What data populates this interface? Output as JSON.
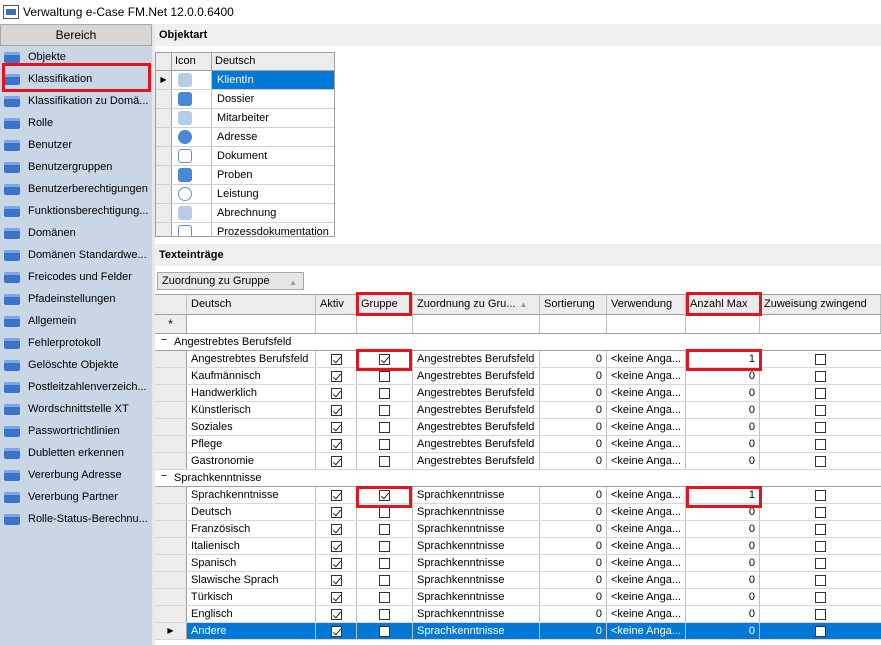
{
  "window": {
    "title": "Verwaltung e-Case FM.Net 12.0.0.6400"
  },
  "sidebar": {
    "header": "Bereich",
    "items": [
      {
        "label": "Objekte"
      },
      {
        "label": "Klassifikation"
      },
      {
        "label": "Klassifikation zu Domä..."
      },
      {
        "label": "Rolle"
      },
      {
        "label": "Benutzer"
      },
      {
        "label": "Benutzergruppen"
      },
      {
        "label": "Benutzerberechtigungen"
      },
      {
        "label": "Funktionsberechtigung..."
      },
      {
        "label": "Domänen"
      },
      {
        "label": "Domänen Standardwe..."
      },
      {
        "label": "Freicodes und Felder"
      },
      {
        "label": "Pfadeinstellungen"
      },
      {
        "label": "Allgemein"
      },
      {
        "label": "Fehlerprotokoll"
      },
      {
        "label": "Gelöschte Objekte"
      },
      {
        "label": "Postleitzahlenverzeich..."
      },
      {
        "label": "Wordschnittstelle XT"
      },
      {
        "label": "Passwortrichtlinien"
      },
      {
        "label": "Dubletten erkennen"
      },
      {
        "label": "Vererbung Adresse"
      },
      {
        "label": "Vererbung Partner"
      },
      {
        "label": "Rolle-Status-Berechnu..."
      }
    ]
  },
  "objektart": {
    "title": "Objektart",
    "col_icon": "Icon",
    "col_name": "Deutsch",
    "rows": [
      {
        "name": "KlientIn",
        "icon": "person-icon"
      },
      {
        "name": "Dossier",
        "icon": "folder-icon"
      },
      {
        "name": "Mitarbeiter",
        "icon": "person-icon"
      },
      {
        "name": "Adresse",
        "icon": "address-icon"
      },
      {
        "name": "Dokument",
        "icon": "document-icon"
      },
      {
        "name": "Proben",
        "icon": "pen-icon"
      },
      {
        "name": "Leistung",
        "icon": "clock-icon"
      },
      {
        "name": "Abrechnung",
        "icon": "billing-icon"
      },
      {
        "name": "Prozessdokumentation",
        "icon": "abc-icon"
      }
    ]
  },
  "texteintraege": {
    "title": "Texteinträge",
    "group_button": "Zuordnung zu Gruppe",
    "headers": {
      "deutsch": "Deutsch",
      "aktiv": "Aktiv",
      "gruppe": "Gruppe",
      "zuordnung": "Zuordnung zu Gru...",
      "sortierung": "Sortierung",
      "verwendung": "Verwendung",
      "anzahl": "Anzahl Max",
      "zwingend": "Zuweisung zwingend"
    },
    "newrow_marker": "*",
    "groups": [
      {
        "label": "Angestrebtes Berufsfeld",
        "toggle": "−",
        "rows": [
          {
            "name": "Angestrebtes Berufsfeld",
            "aktiv": true,
            "gruppe": true,
            "zuordnung": "Angestrebtes Berufsfeld",
            "sortierung": "0",
            "verwendung": "<keine Anga...",
            "anzahl": "1",
            "zwingend": false
          },
          {
            "name": "Kaufmännisch",
            "aktiv": true,
            "gruppe": false,
            "zuordnung": "Angestrebtes Berufsfeld",
            "sortierung": "0",
            "verwendung": "<keine Anga...",
            "anzahl": "0",
            "zwingend": false
          },
          {
            "name": "Handwerklich",
            "aktiv": true,
            "gruppe": false,
            "zuordnung": "Angestrebtes Berufsfeld",
            "sortierung": "0",
            "verwendung": "<keine Anga...",
            "anzahl": "0",
            "zwingend": false
          },
          {
            "name": "Künstlerisch",
            "aktiv": true,
            "gruppe": false,
            "zuordnung": "Angestrebtes Berufsfeld",
            "sortierung": "0",
            "verwendung": "<keine Anga...",
            "anzahl": "0",
            "zwingend": false
          },
          {
            "name": "Soziales",
            "aktiv": true,
            "gruppe": false,
            "zuordnung": "Angestrebtes Berufsfeld",
            "sortierung": "0",
            "verwendung": "<keine Anga...",
            "anzahl": "0",
            "zwingend": false
          },
          {
            "name": "Pflege",
            "aktiv": true,
            "gruppe": false,
            "zuordnung": "Angestrebtes Berufsfeld",
            "sortierung": "0",
            "verwendung": "<keine Anga...",
            "anzahl": "0",
            "zwingend": false
          },
          {
            "name": "Gastronomie",
            "aktiv": true,
            "gruppe": false,
            "zuordnung": "Angestrebtes Berufsfeld",
            "sortierung": "0",
            "verwendung": "<keine Anga...",
            "anzahl": "0",
            "zwingend": false
          }
        ]
      },
      {
        "label": "Sprachkenntnisse",
        "toggle": "−",
        "rows": [
          {
            "name": "Sprachkenntnisse",
            "aktiv": true,
            "gruppe": true,
            "zuordnung": "Sprachkenntnisse",
            "sortierung": "0",
            "verwendung": "<keine Anga...",
            "anzahl": "1",
            "zwingend": false
          },
          {
            "name": "Deutsch",
            "aktiv": true,
            "gruppe": false,
            "zuordnung": "Sprachkenntnisse",
            "sortierung": "0",
            "verwendung": "<keine Anga...",
            "anzahl": "0",
            "zwingend": false
          },
          {
            "name": "Französisch",
            "aktiv": true,
            "gruppe": false,
            "zuordnung": "Sprachkenntnisse",
            "sortierung": "0",
            "verwendung": "<keine Anga...",
            "anzahl": "0",
            "zwingend": false
          },
          {
            "name": "Italienisch",
            "aktiv": true,
            "gruppe": false,
            "zuordnung": "Sprachkenntnisse",
            "sortierung": "0",
            "verwendung": "<keine Anga...",
            "anzahl": "0",
            "zwingend": false
          },
          {
            "name": "Spanisch",
            "aktiv": true,
            "gruppe": false,
            "zuordnung": "Sprachkenntnisse",
            "sortierung": "0",
            "verwendung": "<keine Anga...",
            "anzahl": "0",
            "zwingend": false
          },
          {
            "name": "Slawische Sprach",
            "aktiv": true,
            "gruppe": false,
            "zuordnung": "Sprachkenntnisse",
            "sortierung": "0",
            "verwendung": "<keine Anga...",
            "anzahl": "0",
            "zwingend": false
          },
          {
            "name": "Türkisch",
            "aktiv": true,
            "gruppe": false,
            "zuordnung": "Sprachkenntnisse",
            "sortierung": "0",
            "verwendung": "<keine Anga...",
            "anzahl": "0",
            "zwingend": false
          },
          {
            "name": "Englisch",
            "aktiv": true,
            "gruppe": false,
            "zuordnung": "Sprachkenntnisse",
            "sortierung": "0",
            "verwendung": "<keine Anga...",
            "anzahl": "0",
            "zwingend": false
          },
          {
            "name": "Andere",
            "aktiv": true,
            "gruppe": false,
            "zuordnung": "Sprachkenntnisse",
            "sortierung": "0",
            "verwendung": "<keine Anga...",
            "anzahl": "0",
            "zwingend": false,
            "selected": true
          }
        ]
      }
    ]
  },
  "colors": {
    "selection": "#0078d7",
    "highlight": "#e2141c",
    "sidebar_bg": "#c9d6e6"
  }
}
